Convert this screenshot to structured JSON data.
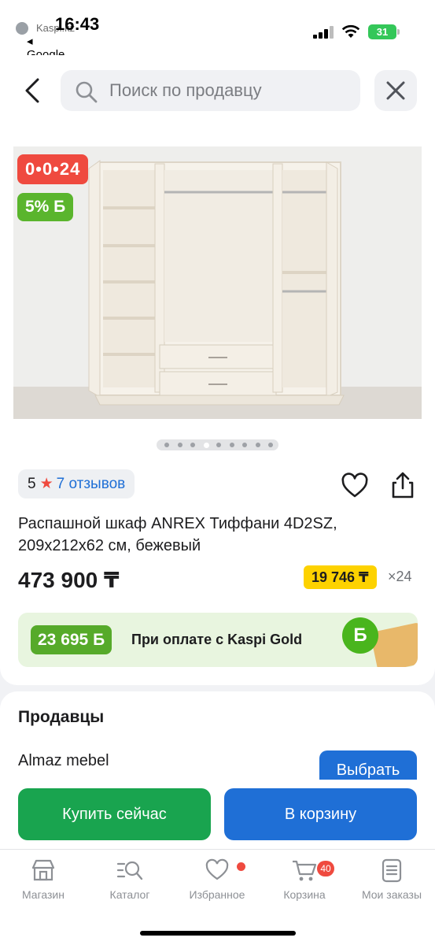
{
  "status_bar": {
    "time": "16:43",
    "back_app_small": "Kaspi.kz",
    "back_app": "◂ Google",
    "battery": "31"
  },
  "search": {
    "placeholder": "Поиск по продавцу"
  },
  "product": {
    "timer_badge": "0•0•24",
    "bonus_badge": "5% Б",
    "gallery": {
      "total_photos": 9,
      "active_index": 4
    },
    "rating_value": "5",
    "reviews_label": "7 отзывов",
    "title": "Распашной шкаф ANREX Тиффани 4D2SZ, 209x212x62 см, бежевый",
    "price": "473 900 ₸",
    "installment_price": "19 746 ₸",
    "installment_months": "×24"
  },
  "kaspi_gold": {
    "amount": "23 695 Б",
    "label": "При оплате с Kaspi Gold",
    "coin": "Б"
  },
  "sellers": {
    "heading": "Продавцы",
    "first_seller": "Almaz mebel",
    "select_label": "Выбрать"
  },
  "actions": {
    "buy_now": "Купить сейчас",
    "add_to_cart": "В корзину"
  },
  "tabbar": {
    "items": [
      {
        "label": "Магазин",
        "icon": "shop-icon"
      },
      {
        "label": "Каталог",
        "icon": "catalog-search-icon"
      },
      {
        "label": "Избранное",
        "icon": "heart-icon"
      },
      {
        "label": "Корзина",
        "icon": "cart-icon",
        "badge": "40"
      },
      {
        "label": "Мои заказы",
        "icon": "orders-icon"
      }
    ]
  },
  "colors": {
    "accent_blue": "#1f6fd6",
    "buy_green": "#19a44f",
    "sale_red": "#ef4a3f",
    "installment_yellow": "#fdd200"
  }
}
